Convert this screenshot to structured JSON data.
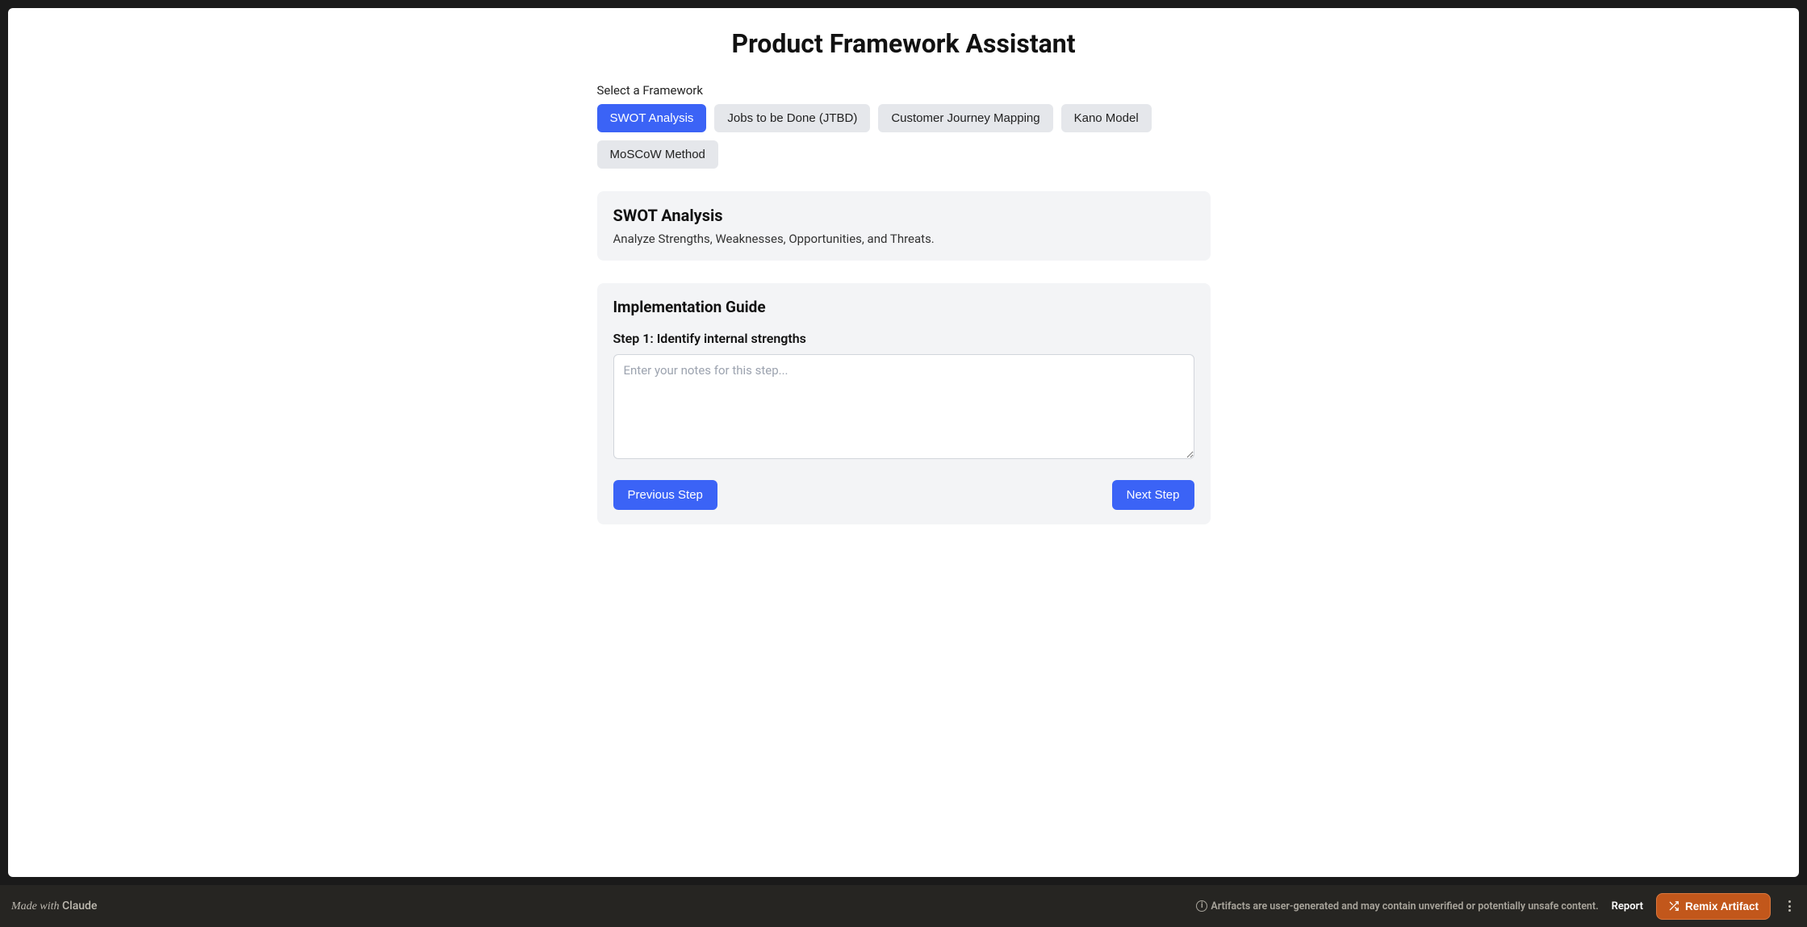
{
  "page_title": "Product Framework Assistant",
  "framework_select_label": "Select a Framework",
  "frameworks": [
    {
      "label": "SWOT Analysis",
      "selected": true
    },
    {
      "label": "Jobs to be Done (JTBD)",
      "selected": false
    },
    {
      "label": "Customer Journey Mapping",
      "selected": false
    },
    {
      "label": "Kano Model",
      "selected": false
    },
    {
      "label": "MoSCoW Method",
      "selected": false
    }
  ],
  "framework_card": {
    "title": "SWOT Analysis",
    "description": "Analyze Strengths, Weaknesses, Opportunities, and Threats."
  },
  "guide": {
    "title": "Implementation Guide",
    "step_label": "Step 1: Identify internal strengths",
    "textarea_placeholder": "Enter your notes for this step...",
    "textarea_value": "",
    "prev_label": "Previous Step",
    "next_label": "Next Step"
  },
  "footer": {
    "made_with_prefix": "Made with ",
    "made_with_brand": "Claude",
    "disclaimer": "Artifacts are user-generated and may contain unverified or potentially unsafe content.",
    "report_label": "Report",
    "remix_label": "Remix Artifact"
  }
}
